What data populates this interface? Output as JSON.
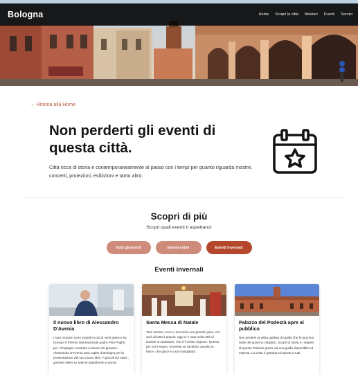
{
  "header": {
    "brand": "Bologna",
    "nav": [
      "Home",
      "Scopri la città",
      "Itinerari",
      "Eventi",
      "Servizi"
    ]
  },
  "back_link": "← Ritorna alla Home",
  "hero_section": {
    "title": "Non perderti gli eventi di questa città.",
    "description": "Città ricca di storia e contemporaneamente al passo con i tempi per quanto riguarda mostre, concerti, proiezioni, esibizioni e tanto altro.",
    "icon": "calendar-star-icon"
  },
  "discover": {
    "title": "Scopri di più",
    "subtitle": "Scopri quali eventi ti aspettano!",
    "filters": [
      "Tutti gli eventi",
      "Eventi estivi",
      "Eventi invernali"
    ],
    "active_filter": "Eventi invernali"
  },
  "events": {
    "section_title": "Eventi invernali",
    "cards": [
      {
        "title": "Il nuovo libro di Alessandro D'Avenia",
        "text": "I suoi romanzi sono tradotti in più di venti paesi e ha ricevuto il Premio Internazionale padre Pino Puglisi per «l'impegno mostrato a favore dei giovani». Alessandro D'Avenia sarà ospite di Bologna per la presentazione del suo nuovo libro 'A piccoli sul mare', già best seller su tutte le piattaforme e anche"
      },
      {
        "title": "Santa Messa di Natale",
        "text": "'Non temete, ecco vi annunzio una grande gioia, che sarà di tutto il popolo: oggi vi è nato nella città di Davide un salvatore, che è il Cristo Signore. Questo per voi il segno: troverete un bambino avvolto in fasce, che giace in una mangiatoia'."
      },
      {
        "title": "Palazzo del Podestà apre al pubblico",
        "text": "Non perderti la visita guidata di quella che fu la prima sede del governo cittadino. Scopri la storia e i segreti di questo Palazzo grazie ad una guida disponibile ed esperta. La visita è gratuita ed aperta a tutti."
      }
    ]
  },
  "colors": {
    "accent": "#b5482c",
    "accent_light": "#d08c7a",
    "navbar": "#0b0b0b"
  }
}
